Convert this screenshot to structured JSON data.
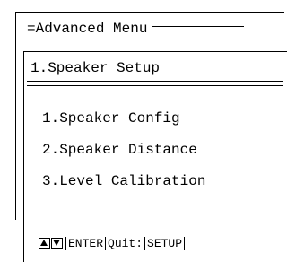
{
  "advanced_menu": {
    "title": "=Advanced Menu"
  },
  "speaker_setup": {
    "title": "1.Speaker Setup",
    "items": [
      {
        "label": "1.Speaker Config"
      },
      {
        "label": "2.Speaker Distance"
      },
      {
        "label": "3.Level Calibration"
      }
    ]
  },
  "footer": {
    "up_icon": "up-arrow-icon",
    "down_icon": "down-arrow-icon",
    "enter_label": "ENTER",
    "quit_label": "Quit:",
    "setup_label": "SETUP"
  }
}
